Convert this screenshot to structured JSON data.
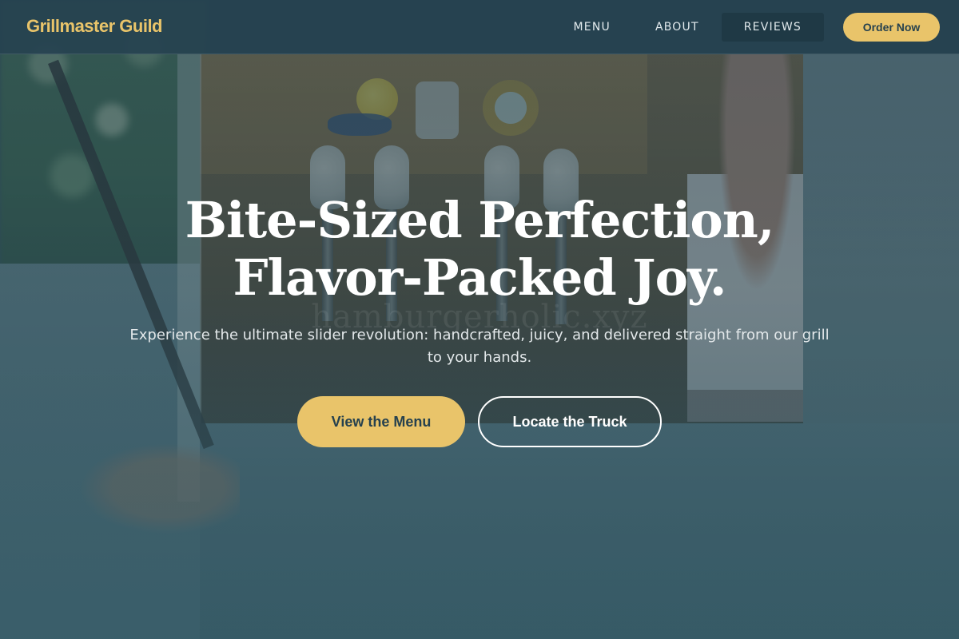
{
  "nav": {
    "brand": "Grillmaster Guild",
    "links": [
      {
        "label": "MENU"
      },
      {
        "label": "ABOUT"
      },
      {
        "label": "REVIEWS"
      }
    ],
    "cta_label": "Order Now"
  },
  "hero": {
    "title_line1": "Bite-Sized Perfection,",
    "title_line2": "Flavor-Packed Joy.",
    "subtitle": "Experience the ultimate slider revolution: handcrafted, juicy, and delivered straight from our grill to your hands.",
    "primary_button": "View the Menu",
    "secondary_button": "Locate the Truck",
    "background_watermark": "hamburgerholic.xyz"
  },
  "colors": {
    "accent": "#e9c46a",
    "nav_background": "#264250",
    "text_dark": "#26414e",
    "text_light": "#ffffff"
  }
}
